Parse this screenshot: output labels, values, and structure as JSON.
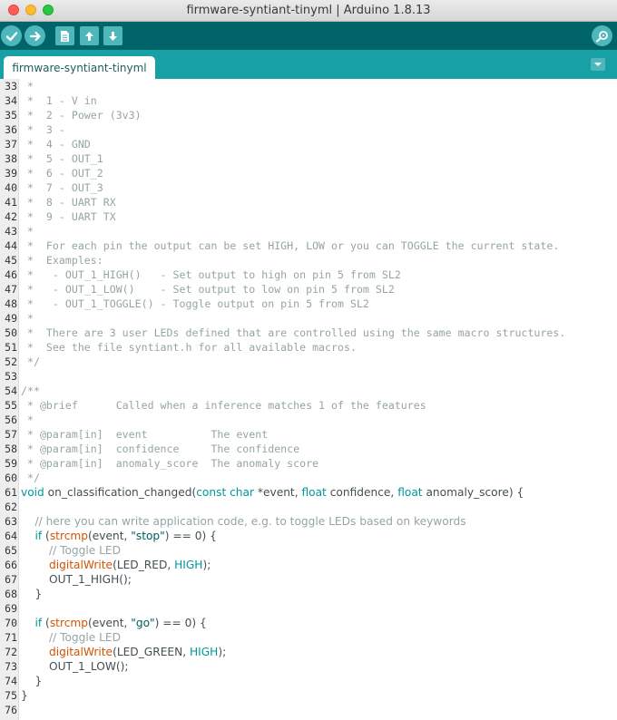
{
  "window": {
    "title": "firmware-syntiant-tinyml | Arduino 1.8.13"
  },
  "toolbar": {
    "buttons": [
      {
        "name": "verify-button",
        "icon": "checkmark-icon"
      },
      {
        "name": "upload-button",
        "icon": "arrow-right-icon"
      },
      {
        "name": "new-button",
        "icon": "document-icon"
      },
      {
        "name": "open-button",
        "icon": "arrow-up-icon"
      },
      {
        "name": "save-button",
        "icon": "arrow-down-icon"
      }
    ],
    "serial_icon": "magnifier-icon"
  },
  "tabs": [
    {
      "label": "firmware-syntiant-tinyml",
      "active": true
    }
  ],
  "colors": {
    "toolbar": "#006468",
    "tabstrip": "#17a1a5",
    "button": "#4db7bb",
    "keyword": "#00979c",
    "function": "#d35400",
    "comment": "#95a5a6",
    "string": "#005c5f"
  },
  "editor": {
    "lines": [
      {
        "n": "33",
        "style": "c",
        "segments": [
          {
            "t": " *"
          }
        ]
      },
      {
        "n": "34",
        "style": "c",
        "segments": [
          {
            "t": " *  1 - V in"
          }
        ]
      },
      {
        "n": "35",
        "style": "c",
        "segments": [
          {
            "t": " *  2 - Power (3v3)"
          }
        ]
      },
      {
        "n": "36",
        "style": "c",
        "segments": [
          {
            "t": " *  3 -"
          }
        ]
      },
      {
        "n": "37",
        "style": "c",
        "segments": [
          {
            "t": " *  4 - GND"
          }
        ]
      },
      {
        "n": "38",
        "style": "c",
        "segments": [
          {
            "t": " *  5 - OUT_1"
          }
        ]
      },
      {
        "n": "39",
        "style": "c",
        "segments": [
          {
            "t": " *  6 - OUT_2"
          }
        ]
      },
      {
        "n": "40",
        "style": "c",
        "segments": [
          {
            "t": " *  7 - OUT_3"
          }
        ]
      },
      {
        "n": "41",
        "style": "c",
        "segments": [
          {
            "t": " *  8 - UART RX"
          }
        ]
      },
      {
        "n": "42",
        "style": "c",
        "segments": [
          {
            "t": " *  9 - UART TX"
          }
        ]
      },
      {
        "n": "43",
        "style": "c",
        "segments": [
          {
            "t": " *"
          }
        ]
      },
      {
        "n": "44",
        "style": "c",
        "segments": [
          {
            "t": " *  For each pin the output can be set HIGH, LOW or you can TOGGLE the current state."
          }
        ]
      },
      {
        "n": "45",
        "style": "c",
        "segments": [
          {
            "t": " *  Examples:"
          }
        ]
      },
      {
        "n": "46",
        "style": "c",
        "segments": [
          {
            "t": " *   - OUT_1_HIGH()   - Set output to high on pin 5 from SL2"
          }
        ]
      },
      {
        "n": "47",
        "style": "c",
        "segments": [
          {
            "t": " *   - OUT_1_LOW()    - Set output to low on pin 5 from SL2"
          }
        ]
      },
      {
        "n": "48",
        "style": "c",
        "segments": [
          {
            "t": " *   - OUT_1_TOGGLE() - Toggle output on pin 5 from SL2"
          }
        ]
      },
      {
        "n": "49",
        "style": "c",
        "segments": [
          {
            "t": " *"
          }
        ]
      },
      {
        "n": "50",
        "style": "c",
        "segments": [
          {
            "t": " *  There are 3 user LEDs defined that are controlled using the same macro structures."
          }
        ]
      },
      {
        "n": "51",
        "style": "c",
        "segments": [
          {
            "t": " *  See the file syntiant.h for all available macros."
          }
        ]
      },
      {
        "n": "52",
        "style": "c",
        "segments": [
          {
            "t": " */"
          }
        ]
      },
      {
        "n": "53",
        "style": "c",
        "segments": [
          {
            "t": ""
          }
        ]
      },
      {
        "n": "54",
        "style": "c",
        "segments": [
          {
            "t": "/**"
          }
        ]
      },
      {
        "n": "55",
        "style": "c",
        "segments": [
          {
            "t": " * @brief      Called when a inference matches 1 of the features"
          }
        ]
      },
      {
        "n": "56",
        "style": "c",
        "segments": [
          {
            "t": " *"
          }
        ]
      },
      {
        "n": "57",
        "style": "c",
        "segments": [
          {
            "t": " * @param[in]  event          The event"
          }
        ]
      },
      {
        "n": "58",
        "style": "c",
        "segments": [
          {
            "t": " * @param[in]  confidence     The confidence"
          }
        ]
      },
      {
        "n": "59",
        "style": "c",
        "segments": [
          {
            "t": " * @param[in]  anomaly_score  The anomaly score"
          }
        ]
      },
      {
        "n": "60",
        "style": "c",
        "segments": [
          {
            "t": " */"
          }
        ]
      },
      {
        "n": "61",
        "style": "p",
        "segments": [
          {
            "t": "void",
            "k": "k"
          },
          {
            "t": " on_classification_changed("
          },
          {
            "t": "const",
            "k": "k"
          },
          {
            "t": " "
          },
          {
            "t": "char",
            "k": "k"
          },
          {
            "t": " *event, "
          },
          {
            "t": "float",
            "k": "k"
          },
          {
            "t": " confidence, "
          },
          {
            "t": "float",
            "k": "k"
          },
          {
            "t": " anomaly_score) {"
          }
        ]
      },
      {
        "n": "62",
        "style": "p",
        "segments": [
          {
            "t": ""
          }
        ]
      },
      {
        "n": "63",
        "style": "p",
        "segments": [
          {
            "t": "    "
          },
          {
            "t": "// here you can write application code, e.g. to toggle LEDs based on keywords",
            "k": "cm"
          }
        ]
      },
      {
        "n": "64",
        "style": "p",
        "segments": [
          {
            "t": "    "
          },
          {
            "t": "if",
            "k": "k"
          },
          {
            "t": " ("
          },
          {
            "t": "strcmp",
            "k": "f"
          },
          {
            "t": "(event, "
          },
          {
            "t": "\"stop\"",
            "k": "s"
          },
          {
            "t": ") == 0) {"
          }
        ]
      },
      {
        "n": "65",
        "style": "p",
        "segments": [
          {
            "t": "        "
          },
          {
            "t": "// Toggle LED",
            "k": "cm"
          }
        ]
      },
      {
        "n": "66",
        "style": "p",
        "segments": [
          {
            "t": "        "
          },
          {
            "t": "digitalWrite",
            "k": "f"
          },
          {
            "t": "(LED_RED, "
          },
          {
            "t": "HIGH",
            "k": "k"
          },
          {
            "t": ");"
          }
        ]
      },
      {
        "n": "67",
        "style": "p",
        "segments": [
          {
            "t": "        OUT_1_HIGH();"
          }
        ]
      },
      {
        "n": "68",
        "style": "p",
        "segments": [
          {
            "t": "    }"
          }
        ]
      },
      {
        "n": "69",
        "style": "p",
        "segments": [
          {
            "t": ""
          }
        ]
      },
      {
        "n": "70",
        "style": "p",
        "segments": [
          {
            "t": "    "
          },
          {
            "t": "if",
            "k": "k"
          },
          {
            "t": " ("
          },
          {
            "t": "strcmp",
            "k": "f"
          },
          {
            "t": "(event, "
          },
          {
            "t": "\"go\"",
            "k": "s"
          },
          {
            "t": ") == 0) {"
          }
        ]
      },
      {
        "n": "71",
        "style": "p",
        "segments": [
          {
            "t": "        "
          },
          {
            "t": "// Toggle LED",
            "k": "cm"
          }
        ]
      },
      {
        "n": "72",
        "style": "p",
        "segments": [
          {
            "t": "        "
          },
          {
            "t": "digitalWrite",
            "k": "f"
          },
          {
            "t": "(LED_GREEN, "
          },
          {
            "t": "HIGH",
            "k": "k"
          },
          {
            "t": ");"
          }
        ]
      },
      {
        "n": "73",
        "style": "p",
        "segments": [
          {
            "t": "        OUT_1_LOW();"
          }
        ]
      },
      {
        "n": "74",
        "style": "p",
        "segments": [
          {
            "t": "    }"
          }
        ]
      },
      {
        "n": "75",
        "style": "p",
        "segments": [
          {
            "t": "}"
          }
        ]
      },
      {
        "n": "76",
        "style": "p",
        "segments": [
          {
            "t": ""
          }
        ]
      }
    ]
  }
}
